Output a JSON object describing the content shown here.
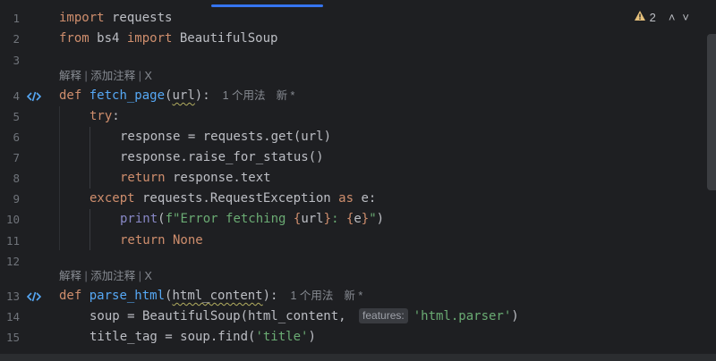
{
  "gutter": {
    "line_numbers": [
      "1",
      "2",
      "3",
      "4",
      "5",
      "6",
      "7",
      "8",
      "9",
      "10",
      "11",
      "12",
      "13",
      "14",
      "15"
    ]
  },
  "code": {
    "l1": {
      "k1": "import",
      "t1": " requests"
    },
    "l2": {
      "k1": "from",
      "t1": " bs4 ",
      "k2": "import",
      "t2": " BeautifulSoup"
    },
    "lens1": {
      "a": "解释",
      "sep1": " | ",
      "b": "添加注释",
      "sep2": " | ",
      "c": "X"
    },
    "l4": {
      "k1": "def",
      "sp": " ",
      "fn": "fetch_page",
      "p1": "(",
      "param": "url",
      "p2": "):",
      "hint_usage": "1 个用法",
      "hint_new": "新 *"
    },
    "l5": {
      "k1": "try",
      "p": ":"
    },
    "l6": {
      "t": "response = requests.get(url)"
    },
    "l7": {
      "t": "response.raise_for_status()"
    },
    "l8": {
      "k1": "return",
      "t": " response.text"
    },
    "l9": {
      "k1": "except",
      "t1": " requests.RequestException ",
      "k2": "as",
      "t2": " e:"
    },
    "l10": {
      "bi": "print",
      "p1": "(",
      "s1": "f\"Error fetching ",
      "br1": "{",
      "v1": "url",
      "br2": "}",
      "s2": ": ",
      "br3": "{",
      "v2": "e",
      "br4": "}",
      "s3": "\"",
      "p2": ")"
    },
    "l11": {
      "k1": "return",
      "k2": " None"
    },
    "lens2": {
      "a": "解释",
      "sep1": " | ",
      "b": "添加注释",
      "sep2": " | ",
      "c": "X"
    },
    "l13": {
      "k1": "def",
      "sp": " ",
      "fn": "parse_html",
      "p1": "(",
      "param": "html_content",
      "p2": "):",
      "hint_usage": "1 个用法",
      "hint_new": "新 *"
    },
    "l14": {
      "t1": "soup = BeautifulSoup(html_content, ",
      "chip": "features:",
      "s": "'html.parser'",
      "t2": ")"
    },
    "l15": {
      "t1": "title_tag = soup.find(",
      "s": "'title'",
      "t2": ")"
    }
  },
  "status": {
    "warning_count": "2",
    "up_arrow": "˄",
    "down_arrow": "˅"
  },
  "colors": {
    "background": "#1e1f22",
    "keyword": "#cf8e6d",
    "function": "#56a8f5",
    "string": "#6aab73",
    "builtin": "#8888c6",
    "accent": "#3574f0",
    "warning": "#e5c07b"
  }
}
